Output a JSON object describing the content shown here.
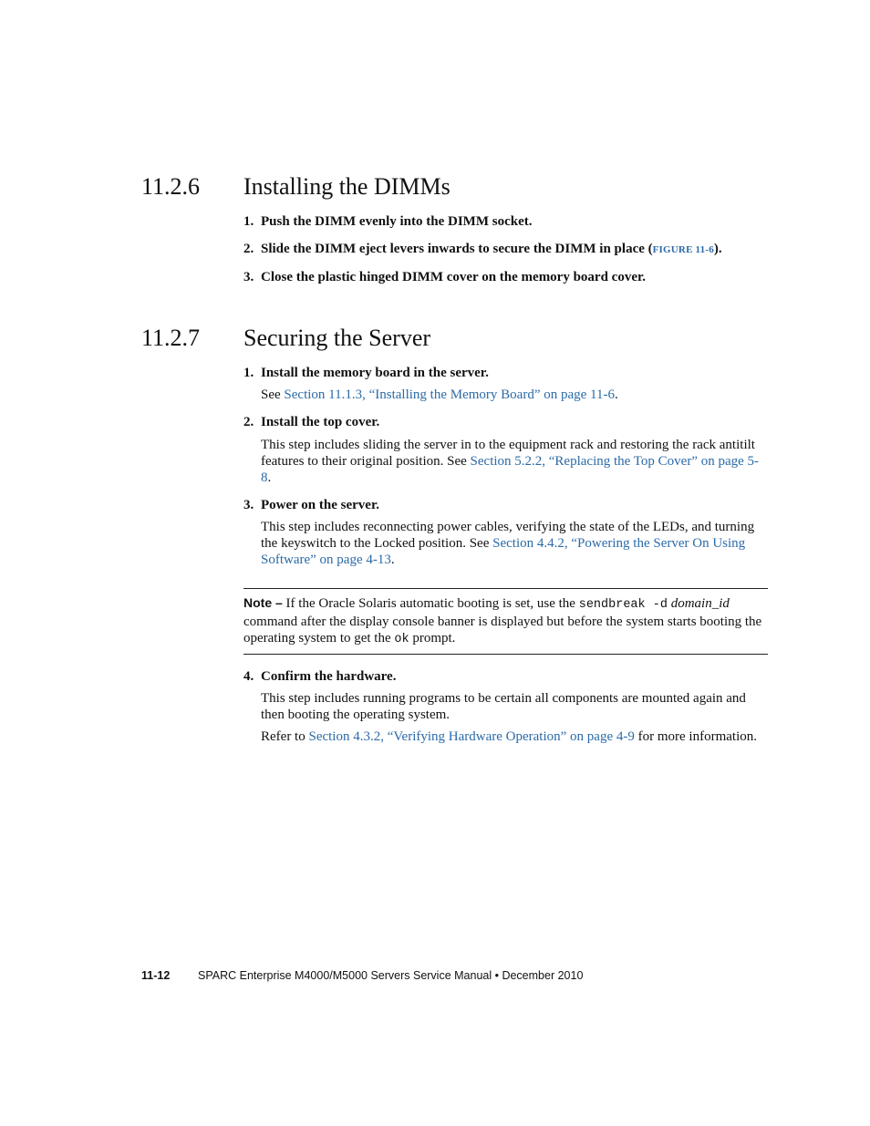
{
  "sections": [
    {
      "number": "11.2.6",
      "title": "Installing the DIMMs",
      "steps": [
        {
          "n": "1.",
          "text": "Push the DIMM evenly into the DIMM socket."
        },
        {
          "n": "2.",
          "text_before": "Slide the DIMM eject levers inwards to secure the DIMM in place (",
          "link": "FIGURE 11-6",
          "text_after": ")."
        },
        {
          "n": "3.",
          "text": "Close the plastic hinged DIMM cover on the memory board cover."
        }
      ]
    },
    {
      "number": "11.2.7",
      "title": "Securing the Server",
      "steps": [
        {
          "n": "1.",
          "text": "Install the memory board in the server.",
          "body_before": "See ",
          "body_link": "Section 11.1.3, “Installing the Memory Board” on page 11-6",
          "body_after": "."
        },
        {
          "n": "2.",
          "text": "Install the top cover.",
          "body_before": "This step includes sliding the server in to the equipment rack and restoring the rack antitilt features to their original position. See ",
          "body_link": "Section 5.2.2, “Replacing the Top Cover” on page 5-8",
          "body_after": "."
        },
        {
          "n": "3.",
          "text": "Power on the server.",
          "body_before": "This step includes reconnecting power cables, verifying the state of the LEDs, and turning the keyswitch to the Locked position. See ",
          "body_link": "Section 4.4.2, “Powering the Server On Using Software” on page 4-13",
          "body_after": "."
        },
        {
          "n": "4.",
          "text": "Confirm the hardware.",
          "body": "This step includes running programs to be certain all components are mounted again and then booting the operating system.",
          "body2_before": "Refer to ",
          "body2_link": "Section 4.3.2, “Verifying Hardware Operation” on page 4-9",
          "body2_after": " for more information."
        }
      ]
    }
  ],
  "note": {
    "label": "Note –",
    "t1": " If the Oracle Solaris automatic booting is set, use the ",
    "code1": "sendbreak -d",
    "italic": "domain_id",
    "t2": " command after the display console banner is displayed but before the system starts booting the operating system to get the ",
    "code2": "ok",
    "t3": " prompt."
  },
  "footer": {
    "page": "11-12",
    "text": "SPARC Enterprise M4000/M5000 Servers Service Manual • December 2010"
  },
  "colors": {
    "link": "#2b6aa8"
  }
}
